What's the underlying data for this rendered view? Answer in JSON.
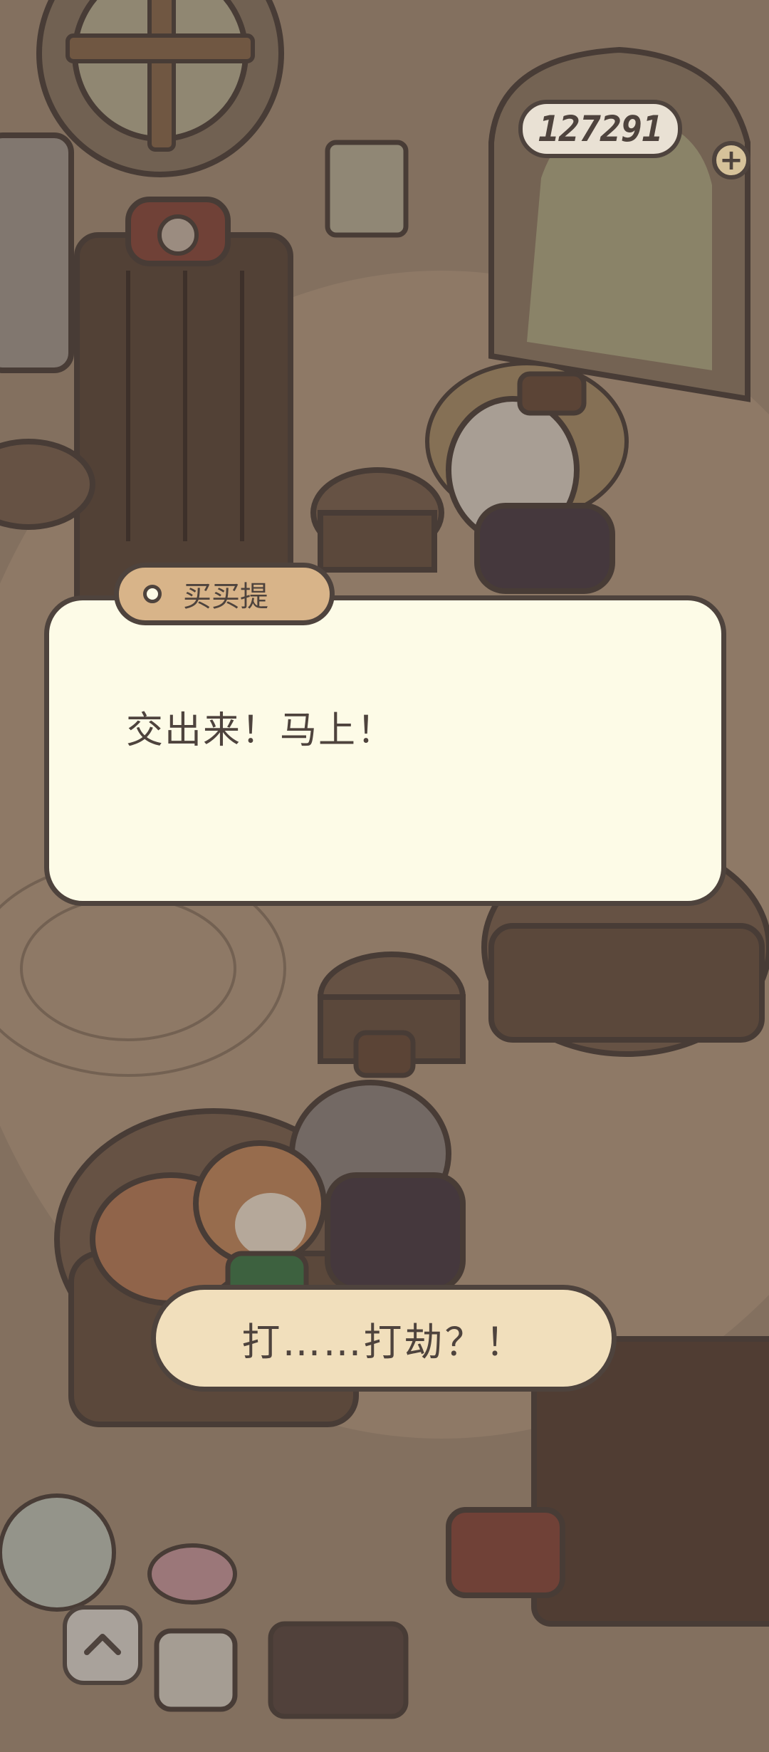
{
  "hud": {
    "currency_amount": "127291",
    "add_currency_icon": "plus-icon"
  },
  "dialog": {
    "speaker_name": "买买提",
    "speaker_icon": "speaker-dot-icon",
    "message": "交出来！马上！"
  },
  "choice": {
    "label": "打……打劫？！"
  },
  "controls": {
    "expand_icon": "chevron-up-icon"
  },
  "colors": {
    "outline": "#4e433d",
    "dialog_bg": "#fdfbe7",
    "name_tag_bg": "#d8b489",
    "choice_bg": "#f1dfbc",
    "dim_overlay": "#3a2f28"
  }
}
